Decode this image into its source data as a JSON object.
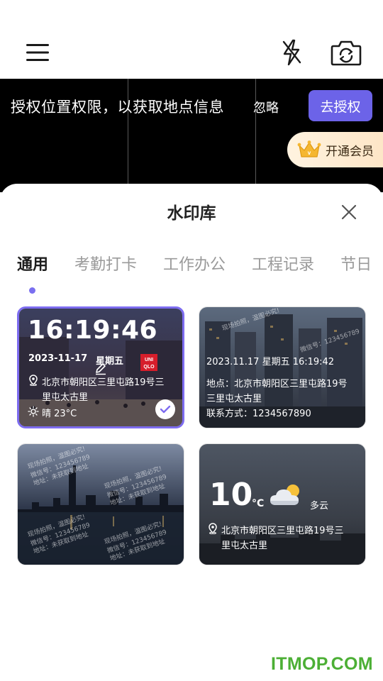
{
  "preview": {
    "permission_text": "授权位置权限，以获取地点信息",
    "ignore_label": "忽略",
    "authorize_label": "去授权",
    "vip_label": "开通会员"
  },
  "sheet": {
    "title": "水印库",
    "tabs": [
      {
        "label": "通用",
        "active": true
      },
      {
        "label": "考勤打卡",
        "active": false
      },
      {
        "label": "工作办公",
        "active": false
      },
      {
        "label": "工程记录",
        "active": false
      },
      {
        "label": "节日",
        "active": false
      }
    ]
  },
  "cards": {
    "c1": {
      "time": "16:19:46",
      "date": "2023-11-17",
      "weekday": "星期五",
      "address_line1": "北京市朝阳区三里屯路19号三",
      "address_line2": "里屯太古里",
      "weather": "晴 23°C",
      "shop_sign": "UNI QLO"
    },
    "c2": {
      "datetime": "2023.11.17   星期五   16:19:42",
      "address_line1": "地点：北京市朝阳区三里屯路19号",
      "address_line2": "三里屯太古里",
      "contact": "联系方式：1234567890"
    },
    "c3": {
      "wm_line1": "现场拍照，温图必究!",
      "wm_line2": "微信号：123456789",
      "wm_line3": "地址：未获取到地址"
    },
    "c4": {
      "temp": "10",
      "unit": "°C",
      "condition": "多云",
      "address_line1": "北京市朝阳区三里屯路19号三",
      "address_line2": "里屯太古里"
    }
  },
  "footer": {
    "logo": "ITMOP.COM"
  },
  "colors": {
    "accent": "#6c63e8",
    "selected_border": "#7d6cf0",
    "logo": "#4caf35"
  }
}
